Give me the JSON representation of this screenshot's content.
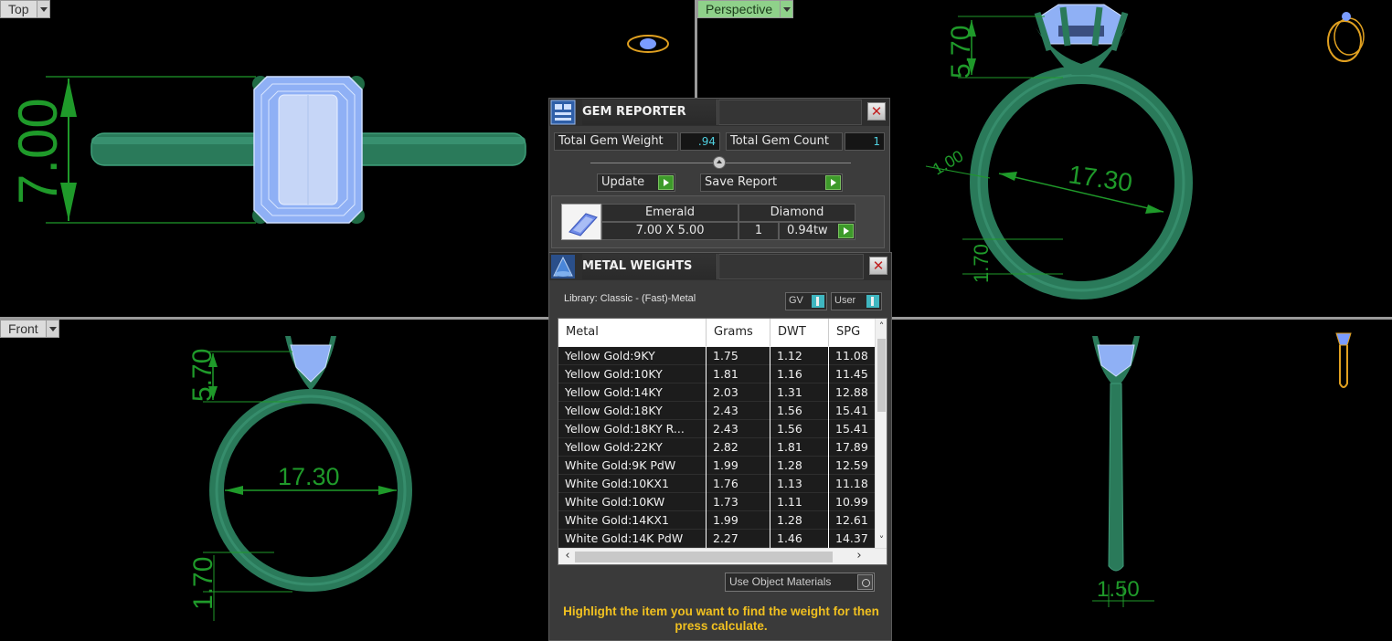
{
  "viewports": {
    "top": {
      "label": "Top",
      "dims": {
        "height": "7.00"
      }
    },
    "perspective": {
      "label": "Perspective",
      "dims": {
        "top": "5.70",
        "side": "1.00",
        "diameter": "17.30",
        "bottom": "1.70"
      }
    },
    "front": {
      "label": "Front",
      "dims": {
        "top": "5.70",
        "diameter": "17.30",
        "bottom": "1.70"
      }
    },
    "right": {
      "dims": {
        "width": "1.50"
      }
    }
  },
  "colors": {
    "ring": "#2a7a5a",
    "gem": "#9ab8ff",
    "dimension": "#1f9a2a",
    "active_label": "#8fd18a",
    "accent": "#3d9a2a"
  },
  "gem_reporter": {
    "title": "GEM REPORTER",
    "total_gem_weight_label": "Total Gem Weight",
    "total_gem_weight": ".94",
    "total_gem_count_label": "Total Gem Count",
    "total_gem_count": "1",
    "update_label": "Update",
    "save_report_label": "Save Report",
    "gem": {
      "shape": "Emerald",
      "size": "7.00 X 5.00",
      "type": "Diamond",
      "count": "1",
      "weight": "0.94tw"
    }
  },
  "metal_weights": {
    "title": "METAL WEIGHTS",
    "library": "Library: Classic - (Fast)-Metal",
    "gv_label": "GV",
    "user_label": "User",
    "columns": [
      "Metal",
      "Grams",
      "DWT",
      "SPG"
    ],
    "rows": [
      [
        "Yellow Gold:9KY",
        "1.75",
        "1.12",
        "11.08"
      ],
      [
        "Yellow Gold:10KY",
        "1.81",
        "1.16",
        "11.45"
      ],
      [
        "Yellow Gold:14KY",
        "2.03",
        "1.31",
        "12.88"
      ],
      [
        "Yellow Gold:18KY",
        "2.43",
        "1.56",
        "15.41"
      ],
      [
        "Yellow Gold:18KY R...",
        "2.43",
        "1.56",
        "15.41"
      ],
      [
        "Yellow Gold:22KY",
        "2.82",
        "1.81",
        "17.89"
      ],
      [
        "White Gold:9K PdW",
        "1.99",
        "1.28",
        "12.59"
      ],
      [
        "White Gold:10KX1",
        "1.76",
        "1.13",
        "11.18"
      ],
      [
        "White Gold:10KW",
        "1.73",
        "1.11",
        "10.99"
      ],
      [
        "White Gold:14KX1",
        "1.99",
        "1.28",
        "12.61"
      ],
      [
        "White Gold:14K PdW",
        "2.27",
        "1.46",
        "14.37"
      ]
    ],
    "use_object_materials_label": "Use Object Materials",
    "hint": "Highlight the item you want to find the weight for then press calculate."
  }
}
